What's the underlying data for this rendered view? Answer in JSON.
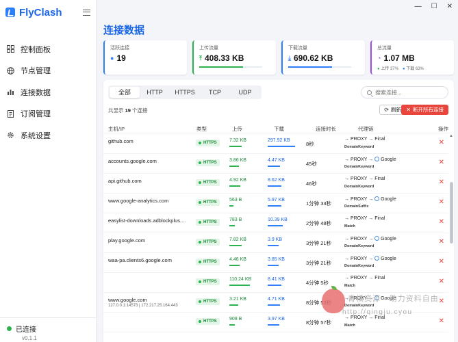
{
  "app": {
    "name": "FlyClash"
  },
  "sidebar": {
    "items": [
      {
        "label": "控制面板",
        "icon": "grid-icon"
      },
      {
        "label": "节点管理",
        "icon": "globe-icon"
      },
      {
        "label": "连接数据",
        "icon": "bar-chart-icon"
      },
      {
        "label": "订阅管理",
        "icon": "document-icon"
      },
      {
        "label": "系统设置",
        "icon": "gear-icon"
      }
    ],
    "status": "已连接",
    "version": "v0.1.1"
  },
  "page": {
    "title": "连接数据"
  },
  "stats": {
    "active": {
      "label": "活跃连接",
      "value": "19"
    },
    "upload": {
      "label": "上传流量",
      "value": "408.33 KB",
      "fill": 0.7
    },
    "download": {
      "label": "下载流量",
      "value": "690.62 KB",
      "fill": 0.7
    },
    "total": {
      "label": "总流量",
      "value": "1.07 MB",
      "up_pct": "上传 37%",
      "down_pct": "下载 63%"
    }
  },
  "toolbar": {
    "tabs": [
      "全部",
      "HTTP",
      "HTTPS",
      "TCP",
      "UDP"
    ],
    "search_placeholder": "搜索连接...",
    "total_prefix": "共显示",
    "total_count": "19",
    "total_suffix": "个连接",
    "refresh_label": "刷新",
    "close_all_label": "断开所有连接"
  },
  "table": {
    "headers": [
      "主机/IP",
      "类型",
      "上传",
      "下载",
      "连接时长",
      "代理链",
      "操作"
    ],
    "rows": [
      {
        "host": "github.com",
        "sub": "",
        "type": "HTTPS",
        "up": "7.32 KB",
        "up_fill": 0.45,
        "down": "297.92 KB",
        "down_fill": 1.0,
        "dur": "8秒",
        "chain": "→ PROXY → Final",
        "globe": false,
        "rule": "DomainKeyword"
      },
      {
        "host": "accounts.google.com",
        "sub": "",
        "type": "HTTPS",
        "up": "3.86 KB",
        "up_fill": 0.35,
        "down": "4.47 KB",
        "down_fill": 0.45,
        "dur": "45秒",
        "chain": "→ PROXY → ",
        "globe": true,
        "chain_tail": "Google",
        "rule": "DomainKeyword"
      },
      {
        "host": "api.github.com",
        "sub": "",
        "type": "HTTPS",
        "up": "4.92 KB",
        "up_fill": 0.4,
        "down": "8.62 KB",
        "down_fill": 0.5,
        "dur": "46秒",
        "chain": "→ PROXY → Final",
        "globe": false,
        "rule": "DomainKeyword"
      },
      {
        "host": "www.google-analytics.com",
        "sub": "",
        "type": "HTTPS",
        "up": "563 B",
        "up_fill": 0.15,
        "down": "5.97 KB",
        "down_fill": 0.5,
        "dur": "1分钟 33秒",
        "chain": "→ PROXY → ",
        "globe": true,
        "chain_tail": "Google",
        "rule": "DomainSuffix"
      },
      {
        "host": "easylist-downloads.adblockplus....",
        "sub": "",
        "type": "HTTPS",
        "up": "783 B",
        "up_fill": 0.2,
        "down": "10.39 KB",
        "down_fill": 0.55,
        "dur": "2分钟 48秒",
        "chain": "→ PROXY → Final",
        "globe": false,
        "rule": "Match"
      },
      {
        "host": "play.google.com",
        "sub": "",
        "type": "HTTPS",
        "up": "7.82 KB",
        "up_fill": 0.45,
        "down": "3.9 KB",
        "down_fill": 0.4,
        "dur": "3分钟 21秒",
        "chain": "→ PROXY → ",
        "globe": true,
        "chain_tail": "Google",
        "rule": "DomainKeyword"
      },
      {
        "host": "waa-pa.clients6.google.com",
        "sub": "",
        "type": "HTTPS",
        "up": "4.46 KB",
        "up_fill": 0.38,
        "down": "3.85 KB",
        "down_fill": 0.4,
        "dur": "3分钟 21秒",
        "chain": "→ PROXY → ",
        "globe": true,
        "chain_tail": "Google",
        "rule": "DomainKeyword"
      },
      {
        "host": "",
        "sub": "",
        "type": "HTTPS",
        "up": "110.24 KB",
        "up_fill": 0.75,
        "down": "8.41 KB",
        "down_fill": 0.5,
        "dur": "4分钟 5秒",
        "chain": "→ PROXY → Final",
        "globe": false,
        "rule": "Match"
      },
      {
        "host": "www.google.com",
        "sub": "127.0.0.1:14573  |  172.217.25.164:443",
        "type": "HTTPS",
        "up": "3.21 KB",
        "up_fill": 0.33,
        "down": "4.71 KB",
        "down_fill": 0.45,
        "dur": "8分钟 53秒",
        "chain": "→ PROXY → ",
        "globe": true,
        "chain_tail": "Google",
        "rule": "DomainKeyword"
      },
      {
        "host": "",
        "sub": "",
        "type": "HTTPS",
        "up": "908 B",
        "up_fill": 0.2,
        "down": "3.97 KB",
        "down_fill": 0.42,
        "dur": "8分钟 57秒",
        "chain": "→ PROXY → Final",
        "globe": false,
        "rule": "Match"
      }
    ]
  },
  "watermark": {
    "line1": "青橘资源 - 助力资料自由",
    "line2": "http://qingju.cyou"
  },
  "colors": {
    "accent": "#1b66e4",
    "green": "#2bb24c",
    "red": "#e8453c",
    "purple": "#9b4de0"
  }
}
